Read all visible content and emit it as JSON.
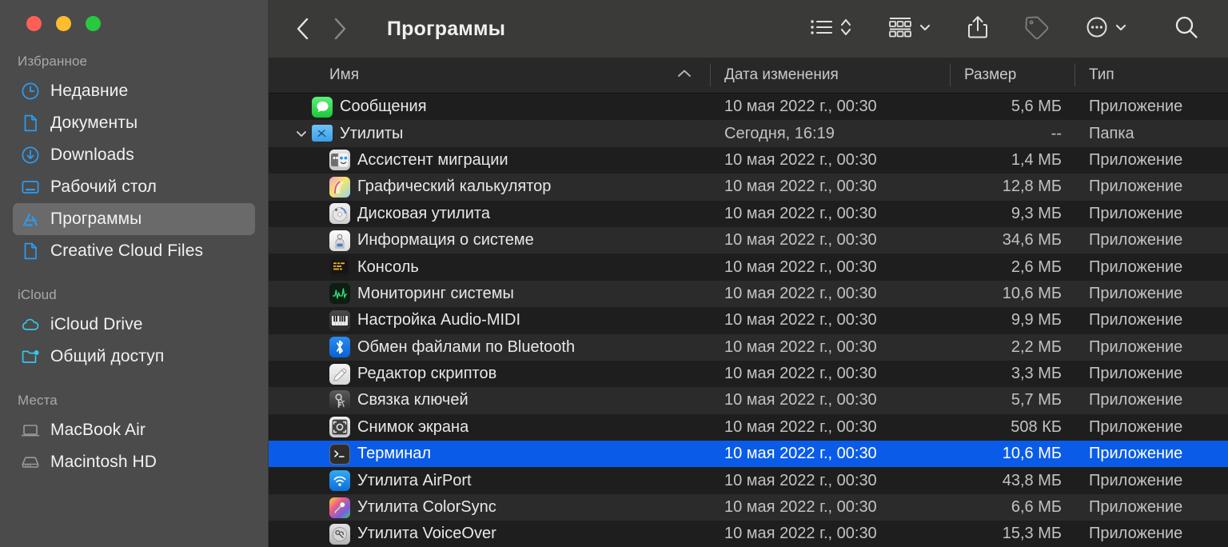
{
  "window": {
    "traffic_lights": [
      "close",
      "minimize",
      "zoom"
    ],
    "colors": {
      "close": "#ff5f57",
      "minimize": "#febc2e",
      "zoom": "#28c840",
      "accent": "#0a5ce8",
      "sidebar_icon": "#2a9cf5"
    }
  },
  "sidebar": {
    "groups": [
      {
        "title": "Избранное",
        "items": [
          {
            "label": "Недавние",
            "icon": "clock-icon",
            "selected": false
          },
          {
            "label": "Документы",
            "icon": "document-icon",
            "selected": false
          },
          {
            "label": "Downloads",
            "icon": "download-icon",
            "selected": false
          },
          {
            "label": "Рабочий стол",
            "icon": "desktop-icon",
            "selected": false
          },
          {
            "label": "Программы",
            "icon": "applications-icon",
            "selected": true
          },
          {
            "label": "Creative Cloud Files",
            "icon": "document-icon",
            "selected": false
          }
        ]
      },
      {
        "title": "iCloud",
        "items": [
          {
            "label": "iCloud Drive",
            "icon": "cloud-icon",
            "selected": false
          },
          {
            "label": "Общий доступ",
            "icon": "shared-folder-icon",
            "selected": false
          }
        ]
      },
      {
        "title": "Места",
        "items": [
          {
            "label": "MacBook Air",
            "icon": "laptop-icon",
            "selected": false
          },
          {
            "label": "Macintosh HD",
            "icon": "harddisk-icon",
            "selected": false
          }
        ]
      }
    ]
  },
  "toolbar": {
    "back_icon": "chevron-left-icon",
    "forward_icon": "chevron-right-icon",
    "title": "Программы",
    "buttons": [
      {
        "name": "view-list",
        "icon": "list-view-icon"
      },
      {
        "name": "group-by",
        "icon": "group-grid-icon"
      },
      {
        "name": "share",
        "icon": "share-icon"
      },
      {
        "name": "tags",
        "icon": "tag-icon"
      },
      {
        "name": "more-actions",
        "icon": "ellipsis-circle-icon"
      },
      {
        "name": "search",
        "icon": "search-icon"
      }
    ]
  },
  "columns": {
    "name": "Имя",
    "date": "Дата изменения",
    "size": "Размер",
    "type": "Тип",
    "sort_icon": "chevron-up-icon",
    "sorted_by": "name",
    "sort_direction": "ascending"
  },
  "files": [
    {
      "name": "Сообщения",
      "date": "10 мая 2022 г., 00:30",
      "size": "5,6 МБ",
      "type": "Приложение",
      "icon": "messages-icon",
      "level": 0,
      "selected": false,
      "expandable": false
    },
    {
      "name": "Утилиты",
      "date": "Сегодня, 16:19",
      "size": "--",
      "type": "Папка",
      "icon": "folder-icon",
      "level": 0,
      "selected": false,
      "expandable": true,
      "expanded": true
    },
    {
      "name": "Ассистент миграции",
      "date": "10 мая 2022 г., 00:30",
      "size": "1,4 МБ",
      "type": "Приложение",
      "icon": "migration-assistant-icon",
      "level": 1,
      "selected": false,
      "expandable": false
    },
    {
      "name": "Графический калькулятор",
      "date": "10 мая 2022 г., 00:30",
      "size": "12,8 МБ",
      "type": "Приложение",
      "icon": "grapher-icon",
      "level": 1,
      "selected": false,
      "expandable": false
    },
    {
      "name": "Дисковая утилита",
      "date": "10 мая 2022 г., 00:30",
      "size": "9,3 МБ",
      "type": "Приложение",
      "icon": "disk-utility-icon",
      "level": 1,
      "selected": false,
      "expandable": false
    },
    {
      "name": "Информация о системе",
      "date": "10 мая 2022 г., 00:30",
      "size": "34,6 МБ",
      "type": "Приложение",
      "icon": "system-information-icon",
      "level": 1,
      "selected": false,
      "expandable": false
    },
    {
      "name": "Консоль",
      "date": "10 мая 2022 г., 00:30",
      "size": "2,6 МБ",
      "type": "Приложение",
      "icon": "console-icon",
      "level": 1,
      "selected": false,
      "expandable": false
    },
    {
      "name": "Мониторинг системы",
      "date": "10 мая 2022 г., 00:30",
      "size": "10,6 МБ",
      "type": "Приложение",
      "icon": "activity-monitor-icon",
      "level": 1,
      "selected": false,
      "expandable": false
    },
    {
      "name": "Настройка Audio-MIDI",
      "date": "10 мая 2022 г., 00:30",
      "size": "9,9 МБ",
      "type": "Приложение",
      "icon": "audio-midi-setup-icon",
      "level": 1,
      "selected": false,
      "expandable": false
    },
    {
      "name": "Обмен файлами по Bluetooth",
      "date": "10 мая 2022 г., 00:30",
      "size": "2,2 МБ",
      "type": "Приложение",
      "icon": "bluetooth-icon",
      "level": 1,
      "selected": false,
      "expandable": false
    },
    {
      "name": "Редактор скриптов",
      "date": "10 мая 2022 г., 00:30",
      "size": "3,3 МБ",
      "type": "Приложение",
      "icon": "script-editor-icon",
      "level": 1,
      "selected": false,
      "expandable": false
    },
    {
      "name": "Связка ключей",
      "date": "10 мая 2022 г., 00:30",
      "size": "5,7 МБ",
      "type": "Приложение",
      "icon": "keychain-access-icon",
      "level": 1,
      "selected": false,
      "expandable": false
    },
    {
      "name": "Снимок экрана",
      "date": "10 мая 2022 г., 00:30",
      "size": "508 КБ",
      "type": "Приложение",
      "icon": "screenshot-icon",
      "level": 1,
      "selected": false,
      "expandable": false
    },
    {
      "name": "Терминал",
      "date": "10 мая 2022 г., 00:30",
      "size": "10,6 МБ",
      "type": "Приложение",
      "icon": "terminal-icon",
      "level": 1,
      "selected": true,
      "expandable": false
    },
    {
      "name": "Утилита AirPort",
      "date": "10 мая 2022 г., 00:30",
      "size": "43,8 МБ",
      "type": "Приложение",
      "icon": "airport-utility-icon",
      "level": 1,
      "selected": false,
      "expandable": false
    },
    {
      "name": "Утилита ColorSync",
      "date": "10 мая 2022 г., 00:30",
      "size": "6,6 МБ",
      "type": "Приложение",
      "icon": "colorsync-icon",
      "level": 1,
      "selected": false,
      "expandable": false
    },
    {
      "name": "Утилита VoiceOver",
      "date": "10 мая 2022 г., 00:30",
      "size": "15,3 МБ",
      "type": "Приложение",
      "icon": "voiceover-icon",
      "level": 1,
      "selected": false,
      "expandable": false
    }
  ]
}
